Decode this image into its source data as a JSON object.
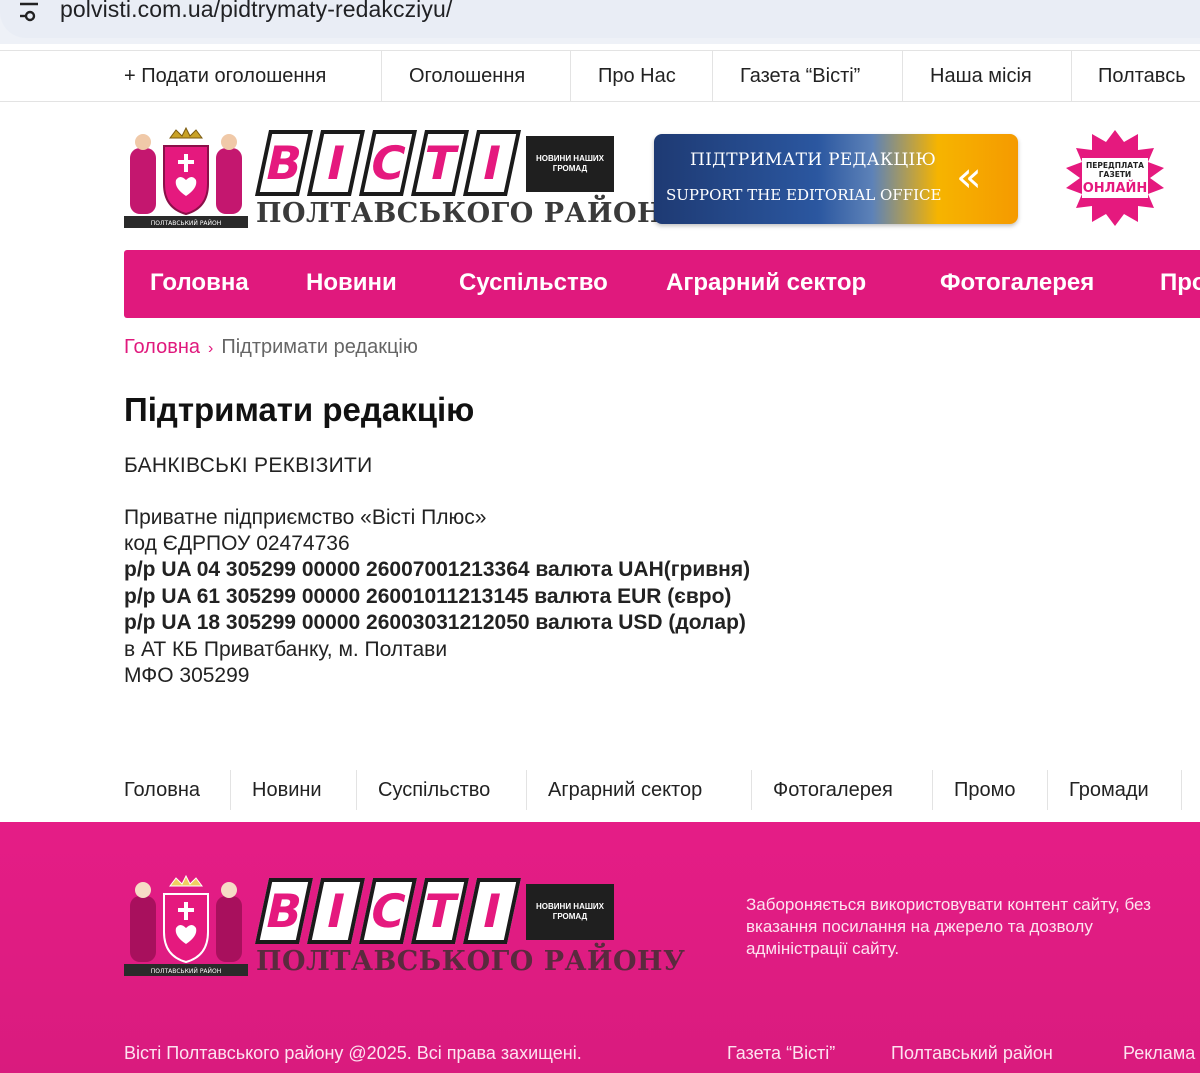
{
  "browser": {
    "url": "polvisti.com.ua/pidtrymaty-redakcziyu/",
    "icon": "tune-icon"
  },
  "top_menu": [
    "+ Подати оголошення",
    "Оголошення",
    "Про Нас",
    "Газета “Вісті”",
    "Наша місія",
    "Полтавсь"
  ],
  "logo": {
    "letters": [
      "В",
      "І",
      "С",
      "Т",
      "І"
    ],
    "tagline": "НОВИНИ НАШИХ ГРОМАД",
    "subtitle": "ПОЛТАВСЬКОГО РАЙОНУ",
    "emblem_caption": "ПОЛТАВСЬКИЙ РАЙОН"
  },
  "support_banner": {
    "line1": "ПІДТРИМАТИ РЕДАКЦІЮ",
    "line2": "SUPPORT THE EDITORIAL OFFICE",
    "arrow": "«"
  },
  "subscribe_badge": {
    "line1": "ПЕРЕДПЛАТА",
    "line2": "ГАЗЕТИ",
    "line3": "ОНЛАЙН"
  },
  "main_nav": [
    "Головна",
    "Новини",
    "Суспільство",
    "Аграрний сектор",
    "Фотогалерея",
    "Про"
  ],
  "breadcrumb": {
    "home": "Головна",
    "separator": "›",
    "current": "Підтримати редакцію"
  },
  "content": {
    "title": "Підтримати редакцію",
    "section": "БАНКІВСЬКІ РЕКВІЗИТИ",
    "lines": [
      {
        "text": "Приватне підприємство «Вісті Плюс»",
        "bold": false
      },
      {
        "text": "код ЄДРПОУ 02474736",
        "bold": false
      },
      {
        "text": "р/р UA 04 305299 00000 26007001213364 валюта UAH(гривня)",
        "bold": true
      },
      {
        "text": "р/р UA 61 305299 00000 26001011213145 валюта EUR (євро)",
        "bold": true
      },
      {
        "text": "р/р UA 18 305299 00000 26003031212050 валюта USD (долар)",
        "bold": true
      },
      {
        "text": "в АТ КБ Приватбанку, м. Полтави",
        "bold": false
      },
      {
        "text": "МФО 305299",
        "bold": false
      }
    ]
  },
  "footer_nav": [
    "Головна",
    "Новини",
    "Суспільство",
    "Аграрний сектор",
    "Фотогалерея",
    "Промо",
    "Громади"
  ],
  "footer": {
    "note": "Забороняється використовувати контент сайту, без вказання посилання на джерело та дозволу адміністрації сайту.",
    "copyright": "Вісті Полтавського району @2025. Всі права захищені.",
    "links": [
      "Газета “Вісті”",
      "Полтавський район",
      "Реклама"
    ]
  },
  "colors": {
    "brand_pink": "#e0197d",
    "banner_blue": "#1e3a73",
    "banner_gold": "#f6b400"
  }
}
